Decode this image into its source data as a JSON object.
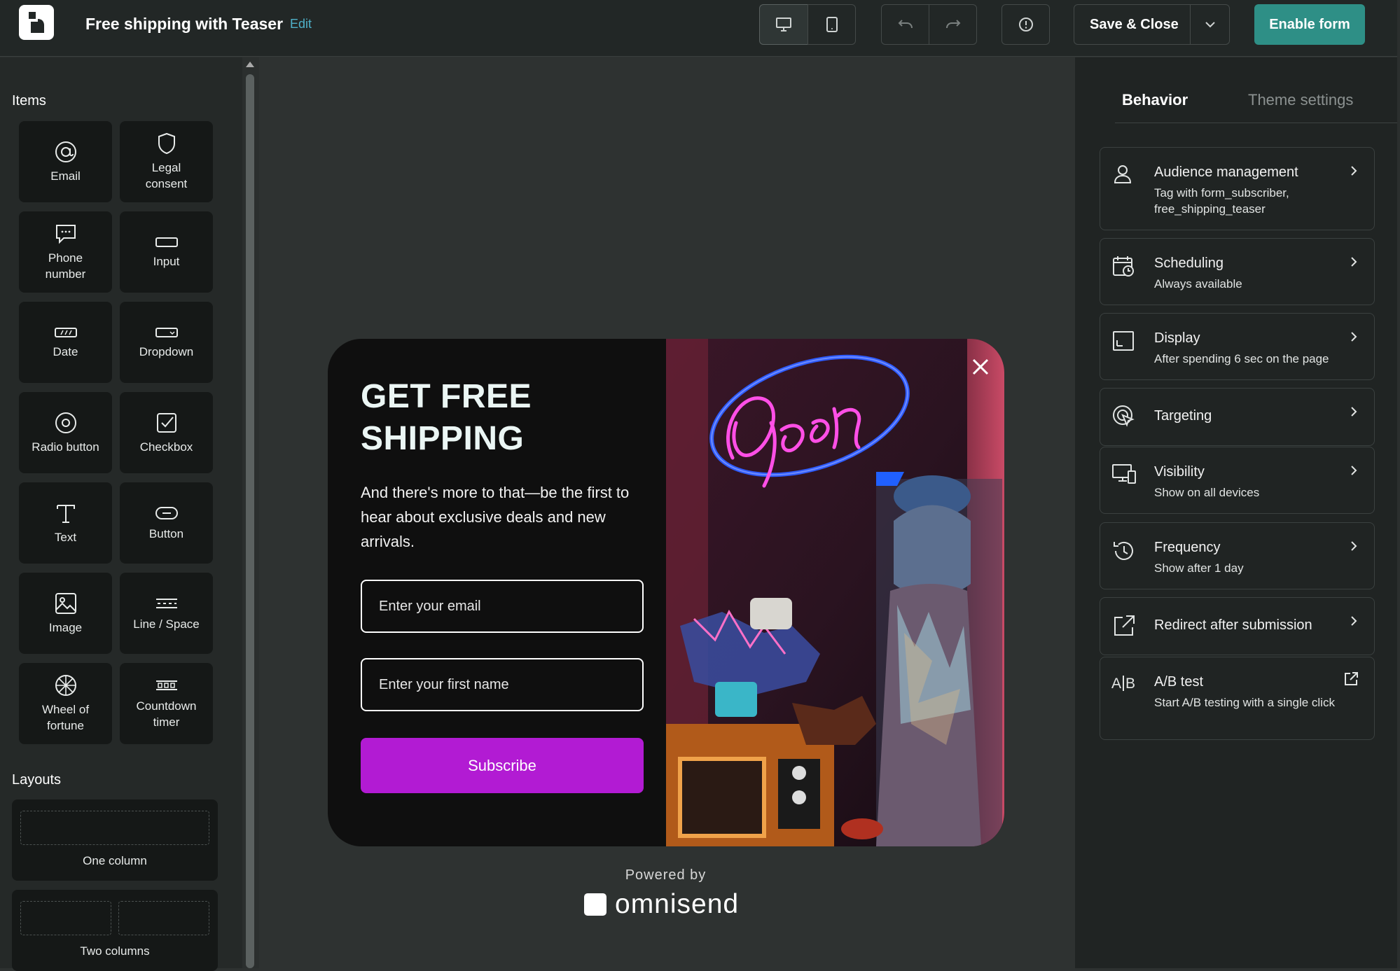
{
  "header": {
    "title": "Free shipping with Teaser",
    "edit_label": "Edit",
    "save_label": "Save & Close",
    "enable_label": "Enable form",
    "accent_color": "#2e8f86"
  },
  "sidebar": {
    "items_heading": "Items",
    "items": [
      {
        "label": "Email",
        "icon": "at-icon"
      },
      {
        "label": "Legal consent",
        "icon": "shield-icon"
      },
      {
        "label": "Phone number",
        "icon": "chat-icon"
      },
      {
        "label": "Input",
        "icon": "input-icon"
      },
      {
        "label": "Date",
        "icon": "date-icon"
      },
      {
        "label": "Dropdown",
        "icon": "dropdown-icon"
      },
      {
        "label": "Radio button",
        "icon": "radio-icon"
      },
      {
        "label": "Checkbox",
        "icon": "checkbox-icon"
      },
      {
        "label": "Text",
        "icon": "text-icon"
      },
      {
        "label": "Button",
        "icon": "button-icon"
      },
      {
        "label": "Image",
        "icon": "image-icon"
      },
      {
        "label": "Line / Space",
        "icon": "line-space-icon"
      },
      {
        "label": "Wheel of fortune",
        "icon": "wheel-icon"
      },
      {
        "label": "Countdown timer",
        "icon": "countdown-icon"
      }
    ],
    "layouts_heading": "Layouts",
    "layouts": [
      {
        "label": "One column"
      },
      {
        "label": "Two columns"
      }
    ]
  },
  "popup": {
    "title_line1": "GET FREE",
    "title_line2": "SHIPPING",
    "text": "And there's more to that—be the first to hear about exclusive deals and new arrivals.",
    "email_placeholder": "Enter your email",
    "name_placeholder": "Enter your first name",
    "subscribe_label": "Subscribe",
    "subscribe_color": "#b21bd3",
    "powered_by": "Powered by",
    "brand": "omnisend"
  },
  "panel": {
    "tab_behavior": "Behavior",
    "tab_theme": "Theme settings",
    "cards": [
      {
        "title": "Audience management",
        "subtitle": "Tag with form_subscriber, free_shipping_teaser",
        "icon": "person-icon"
      },
      {
        "title": "Scheduling",
        "subtitle": "Always available",
        "icon": "calendar-clock-icon"
      },
      {
        "title": "Display",
        "subtitle": "After spending 6 sec on the page",
        "icon": "display-icon"
      },
      {
        "title": "Targeting",
        "subtitle": "",
        "icon": "target-icon"
      },
      {
        "title": "Visibility",
        "subtitle": "Show on all devices",
        "icon": "devices-icon"
      },
      {
        "title": "Frequency",
        "subtitle": "Show after 1 day",
        "icon": "history-icon"
      },
      {
        "title": "Redirect after submission",
        "subtitle": "",
        "icon": "redirect-icon"
      },
      {
        "title": "A/B test",
        "subtitle": "Start A/B testing with a single click",
        "icon": "ab-icon"
      }
    ]
  }
}
